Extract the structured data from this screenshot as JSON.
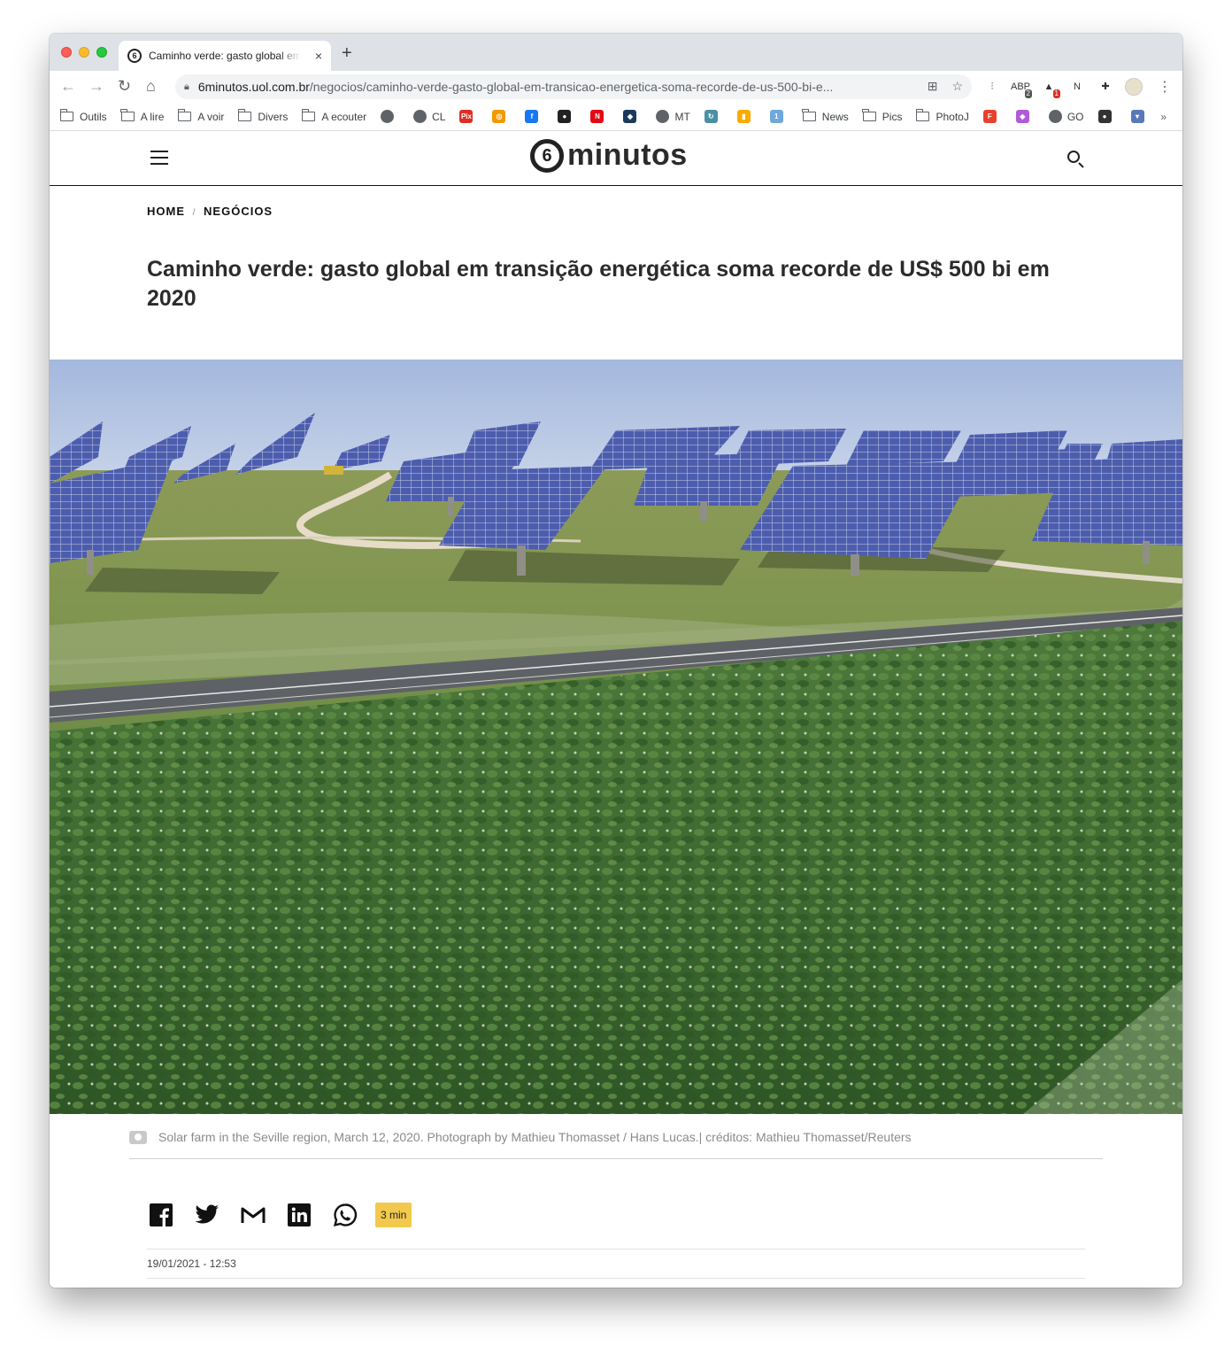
{
  "browser": {
    "tab": {
      "favicon": "6",
      "title": "Caminho verde: gasto global em transição energética",
      "close_glyph": "×"
    },
    "new_tab_glyph": "+",
    "url_host": "6minutos.uol.com.br",
    "url_path": "/negocios/caminho-verde-gasto-global-em-transicao-energetica-soma-recorde-de-us-500-bi-e...",
    "extensions": [
      {
        "icon": "bars-icon",
        "glyph": "⫶"
      },
      {
        "icon": "adblock-icon",
        "glyph": "ABP",
        "badge": "2",
        "badge_color": "#555555"
      },
      {
        "icon": "bell-icon",
        "glyph": "▲",
        "badge": "1",
        "badge_color": "#d93025"
      },
      {
        "icon": "notion-icon",
        "glyph": "N"
      },
      {
        "icon": "puzzle-icon",
        "glyph": "✚"
      }
    ],
    "bookmarks": [
      {
        "type": "folder",
        "label": "Outils"
      },
      {
        "type": "folder",
        "label": "A lire"
      },
      {
        "type": "folder",
        "label": "A voir"
      },
      {
        "type": "folder",
        "label": "Divers"
      },
      {
        "type": "folder",
        "label": "A ecouter"
      },
      {
        "type": "icon",
        "label": "",
        "color": "#5f6368",
        "glyph": ""
      },
      {
        "type": "icon",
        "label": "CL",
        "color": "#5f6368",
        "glyph": ""
      },
      {
        "type": "icon",
        "label": "",
        "color": "#d93025",
        "glyph": "Pix"
      },
      {
        "type": "icon",
        "label": "",
        "color": "#f29900",
        "glyph": "◎"
      },
      {
        "type": "icon",
        "label": "",
        "color": "#1877f2",
        "glyph": "f"
      },
      {
        "type": "icon",
        "label": "",
        "color": "#222222",
        "glyph": "●"
      },
      {
        "type": "icon",
        "label": "",
        "color": "#e50914",
        "glyph": "N"
      },
      {
        "type": "icon",
        "label": "",
        "color": "#1a3a5c",
        "glyph": "◆"
      },
      {
        "type": "icon",
        "label": "MT",
        "color": "#5f6368",
        "glyph": ""
      },
      {
        "type": "icon",
        "label": "",
        "color": "#4a90a4",
        "glyph": "↻"
      },
      {
        "type": "icon",
        "label": "",
        "color": "#f9ab00",
        "glyph": "▮"
      },
      {
        "type": "icon",
        "label": "",
        "color": "#6ea8dc",
        "glyph": "1"
      },
      {
        "type": "folder",
        "label": "News"
      },
      {
        "type": "folder",
        "label": "Pics"
      },
      {
        "type": "folder",
        "label": "PhotoJ"
      },
      {
        "type": "icon",
        "label": "",
        "color": "#e8412c",
        "glyph": "F"
      },
      {
        "type": "icon",
        "label": "",
        "color": "#b05bd9",
        "glyph": "◈"
      },
      {
        "type": "icon",
        "label": "GO",
        "color": "#5f6368",
        "glyph": ""
      },
      {
        "type": "icon",
        "label": "",
        "color": "#333333",
        "glyph": "●"
      },
      {
        "type": "icon",
        "label": "",
        "color": "#5a78b8",
        "glyph": "▾"
      }
    ],
    "bookmarks_more": "»"
  },
  "site": {
    "logo_numeral": "6",
    "logo_word": "minutos"
  },
  "article": {
    "breadcrumb": {
      "home": "HOME",
      "sep": "/",
      "section": "NEGÓCIOS"
    },
    "headline": "Caminho verde: gasto global em transição energética soma recorde de US$ 500 bi em 2020",
    "caption": "Solar farm in the Seville region, March 12, 2020. Photograph by Mathieu Thomasset / Hans Lucas.| créditos: Mathieu Thomasset/Reuters",
    "read_time": "3 min",
    "date": "19/01/2021 - 12:53"
  },
  "colors": {
    "accent_readtime": "#f2c94c",
    "sky": "#a9bde0",
    "panel": "#4f5fae",
    "crop_green": "#3f6e33"
  }
}
